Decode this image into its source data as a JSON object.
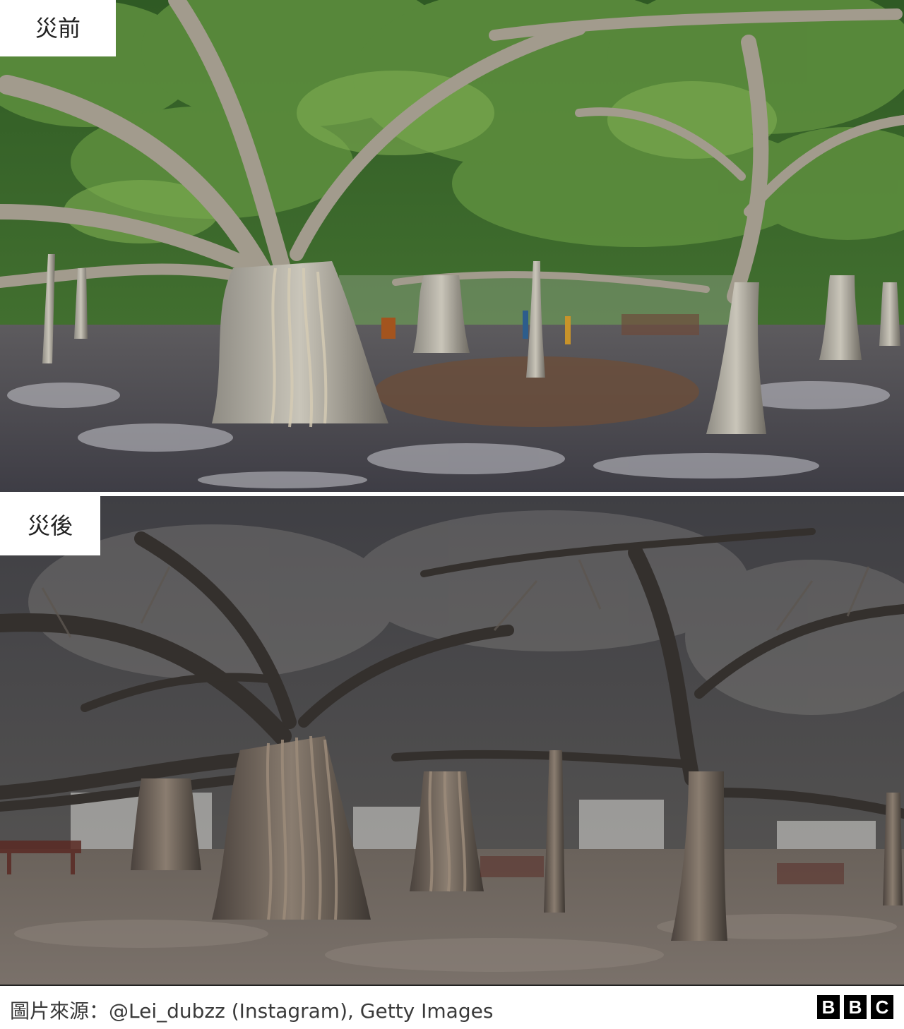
{
  "labels": {
    "before": "災前",
    "after": "災後"
  },
  "credit": "圖片來源：@Lei_dubzz (Instagram), Getty Images",
  "logo": {
    "letters": [
      "B",
      "B",
      "C"
    ]
  },
  "colors": {
    "before_foliage": "#3c6b2c",
    "before_ground": "#5a5a63",
    "after_tone": "#4a4744",
    "logo_bg": "#000000"
  }
}
